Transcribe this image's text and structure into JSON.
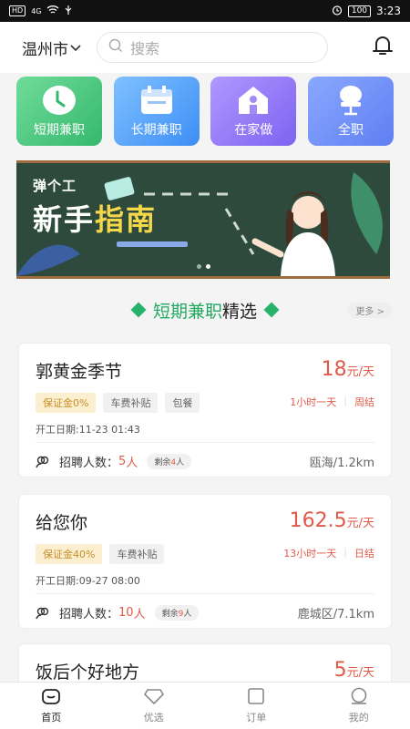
{
  "status_bar": {
    "network": "HD",
    "signal": "4G",
    "battery": "100",
    "time": "3:23"
  },
  "header": {
    "city": "温州市",
    "search_placeholder": "搜索"
  },
  "categories": [
    {
      "label": "短期兼职",
      "icon": "clock-icon"
    },
    {
      "label": "长期兼职",
      "icon": "calendar-icon"
    },
    {
      "label": "在家做",
      "icon": "home-icon"
    },
    {
      "label": "全职",
      "icon": "chair-icon"
    }
  ],
  "banner": {
    "line1": "弹个工",
    "line2_a": "新手",
    "line2_b": "指南"
  },
  "section": {
    "title_highlight": "短期兼职",
    "title_rest": "精选",
    "more": "更多 >"
  },
  "jobs": [
    {
      "title": "郭黄金季节",
      "pay_value": "18",
      "pay_unit": "元/天",
      "tags": [
        "保证金0%",
        "车费补贴",
        "包餐"
      ],
      "hours": "1小时一天",
      "settle": "周结",
      "start_date": "开工日期:11-23 01:43",
      "recruit_label": "招聘人数：",
      "recruit_count": "5",
      "recruit_unit": "人",
      "remain_label": "剩余",
      "remain_count": "4",
      "remain_unit": "人",
      "location": "瓯海/1.2km"
    },
    {
      "title": "给您你",
      "pay_value": "162.5",
      "pay_unit": "元/天",
      "tags": [
        "保证金40%",
        "车费补贴"
      ],
      "hours": "13小时一天",
      "settle": "日结",
      "start_date": "开工日期:09-27 08:00",
      "recruit_label": "招聘人数：",
      "recruit_count": "10",
      "recruit_unit": "人",
      "remain_label": "剩余",
      "remain_count": "9",
      "remain_unit": "人",
      "location": "鹿城区/7.1km"
    },
    {
      "title": "饭后个好地方",
      "pay_value": "5",
      "pay_unit": "元/天"
    }
  ],
  "tabbar": [
    {
      "label": "首页",
      "icon": "home-tab-icon"
    },
    {
      "label": "优选",
      "icon": "diamond-icon"
    },
    {
      "label": "订单",
      "icon": "order-icon"
    },
    {
      "label": "我的",
      "icon": "profile-icon"
    }
  ],
  "colors": {
    "accent_green": "#23a862",
    "price_red": "#e05a4a"
  }
}
